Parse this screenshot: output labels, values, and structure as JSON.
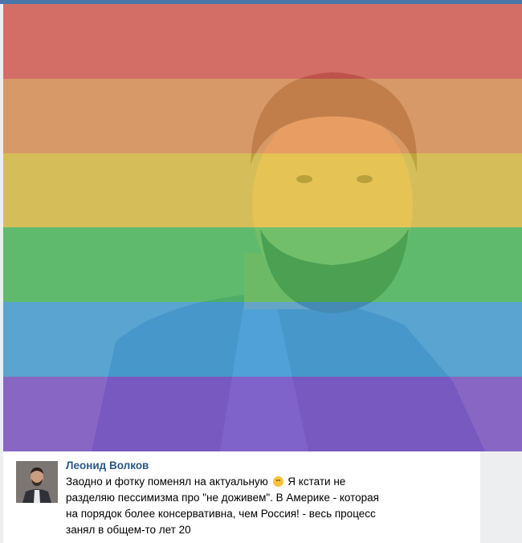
{
  "post": {
    "author": "Леонид Волков",
    "text_part1": "Заодно и фотку поменял на актуальную",
    "text_part2": " Я кстати не\nразделяю пессимизма про \"не доживем\". В Америке - которая\nна порядок более консервативна, чем Россия! - весь процесс\nзанял в общем-то лет 20",
    "emoji": "smile-emoji"
  },
  "photo": {
    "overlay_stripes": [
      "#f07a70",
      "#f5a664",
      "#f2cf55",
      "#5fcf73",
      "#52b2e8",
      "#8b63d6"
    ]
  },
  "colors": {
    "link": "#2a5885",
    "top_bar": "#4a76a8"
  }
}
